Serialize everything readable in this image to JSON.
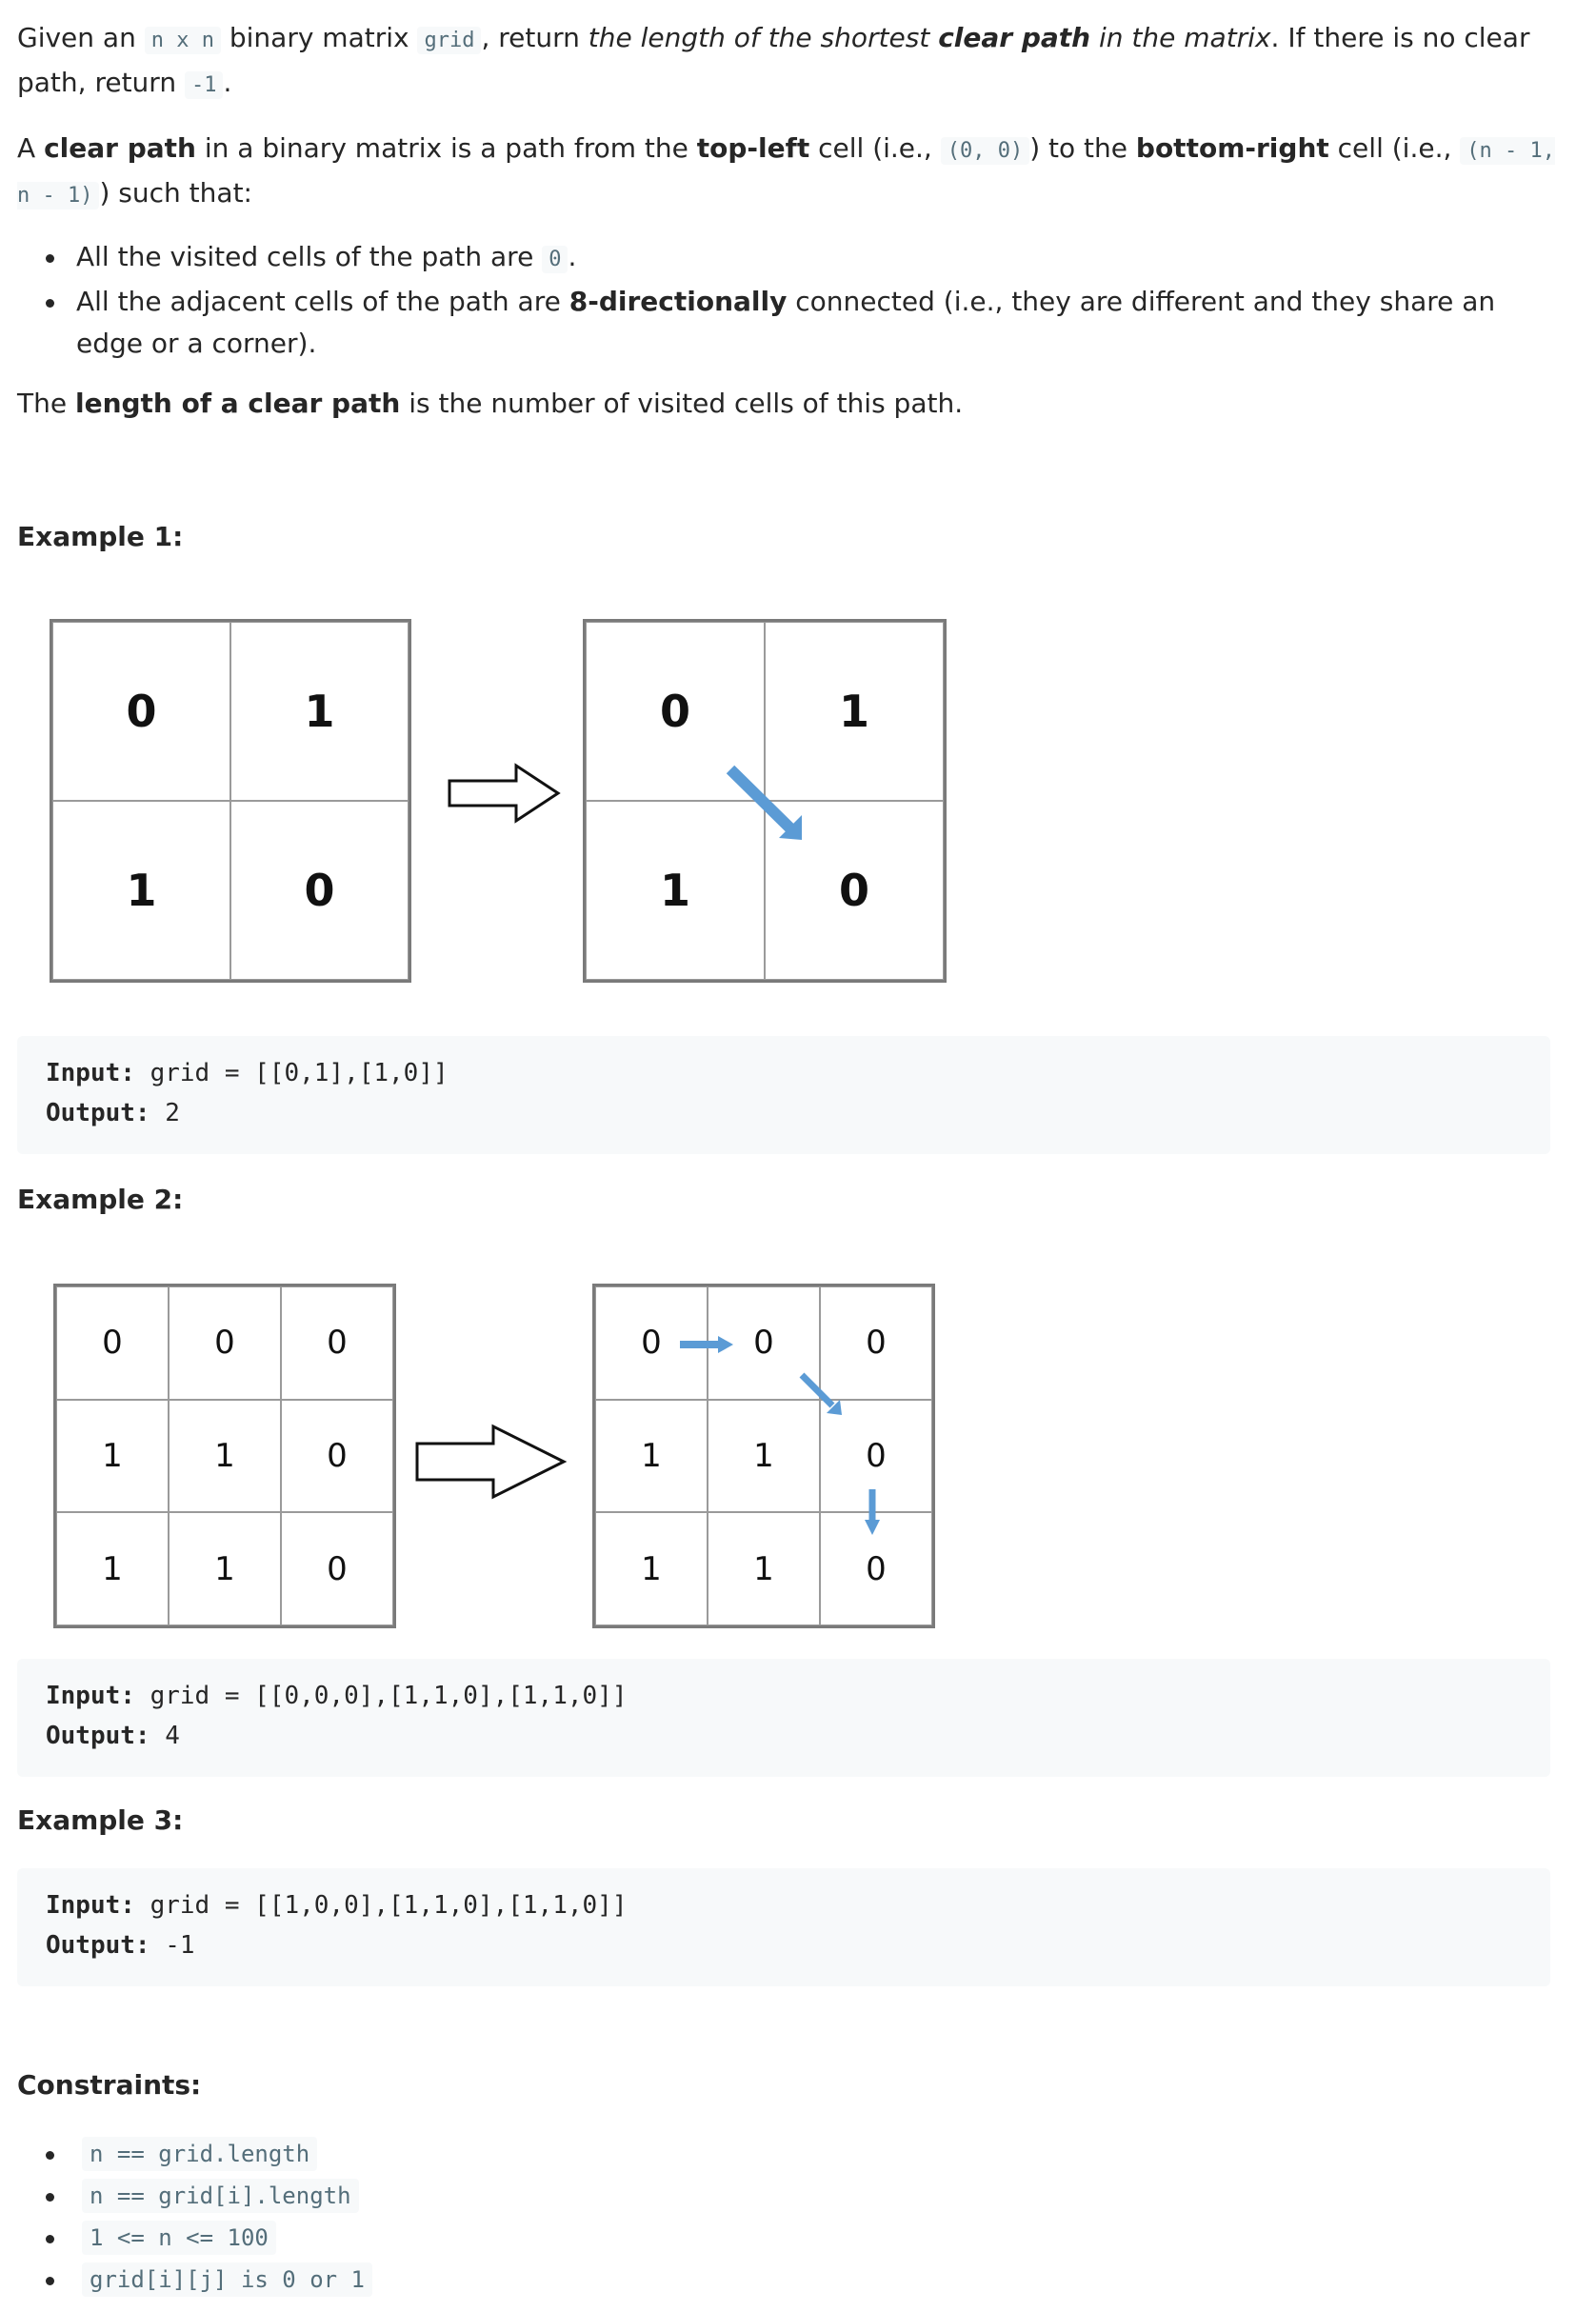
{
  "intro": {
    "p1_a": "Given an ",
    "p1_code_n": "n x n",
    "p1_b": " binary matrix ",
    "p1_code_grid": "grid",
    "p1_c": ", return ",
    "p1_i1": "the length of the shortest ",
    "p1_bi": "clear path",
    "p1_i2": " in the matrix",
    "p1_d": ". If there is no clear path, return ",
    "p1_code_neg": "-1",
    "p1_e": ".",
    "p2_a": "A ",
    "p2_b1": "clear path",
    "p2_c": " in a binary matrix is a path from the ",
    "p2_b2": "top-left",
    "p2_d": " cell (i.e., ",
    "p2_code1": "(0, 0)",
    "p2_e": ") to the ",
    "p2_b3": "bottom-right",
    "p2_f": " cell (i.e., ",
    "p2_code2": "(n - 1, n - 1)",
    "p2_g": ") such that:",
    "bullet1_a": "All the visited cells of the path are ",
    "bullet1_code": "0",
    "bullet1_b": ".",
    "bullet2_a": "All the adjacent cells of the path are ",
    "bullet2_b": "8-directionally",
    "bullet2_c": " connected (i.e., they are different and they share an edge or a corner).",
    "p3_a": "The ",
    "p3_b": "length of a clear path",
    "p3_c": " is the number of visited cells of this path."
  },
  "examples": [
    {
      "title": "Example 1:",
      "input_label": "Input:",
      "input_value": " grid = [[0,1],[1,0]]",
      "output_label": "Output:",
      "output_value": " 2",
      "grid": [
        [
          "0",
          "1"
        ],
        [
          "1",
          "0"
        ]
      ]
    },
    {
      "title": "Example 2:",
      "input_label": "Input:",
      "input_value": " grid = [[0,0,0],[1,1,0],[1,1,0]]",
      "output_label": "Output:",
      "output_value": " 4",
      "grid": [
        [
          "0",
          "0",
          "0"
        ],
        [
          "1",
          "1",
          "0"
        ],
        [
          "1",
          "1",
          "0"
        ]
      ]
    },
    {
      "title": "Example 3:",
      "input_label": "Input:",
      "input_value": " grid = [[1,0,0],[1,1,0],[1,1,0]]",
      "output_label": "Output:",
      "output_value": " -1"
    }
  ],
  "constraints": {
    "title": "Constraints:",
    "items": [
      "n == grid.length",
      "n == grid[i].length",
      "1 <= n <= 100",
      "grid[i][j] is 0 or 1"
    ]
  },
  "colors": {
    "path_arrow": "#5b9bd5",
    "code_bg": "#f7f9fa",
    "code_text": "#546e7a"
  }
}
